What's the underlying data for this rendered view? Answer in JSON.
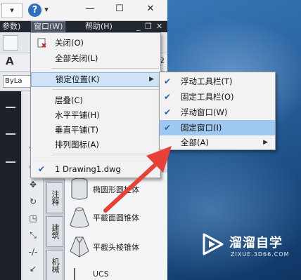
{
  "titlebar": {
    "help_glyph": "?",
    "minimize_glyph": "—",
    "maximize_glyph": "☐",
    "close_glyph": "✕"
  },
  "menubar": {
    "left_fragment": "参数)",
    "window_menu": "窗口(W)",
    "help_menu": "帮助(H)",
    "doc_min": "_",
    "doc_restore": "❐",
    "doc_close": "✕"
  },
  "toolbar": {
    "bylayer": "ByLa",
    "right_fragment": "-2"
  },
  "window_menu": {
    "items": [
      {
        "label": "关闭(O)",
        "icon": "close-document-icon"
      },
      {
        "label": "全部关闭(L)"
      },
      {
        "label": "锁定位置(K)",
        "highlighted": true,
        "has_submenu": true
      },
      {
        "label": "层叠(C)"
      },
      {
        "label": "水平平铺(H)"
      },
      {
        "label": "垂直平铺(T)"
      },
      {
        "label": "排列图标(A)"
      },
      {
        "label": "1 Drawing1.dwg",
        "checked": true
      }
    ]
  },
  "lock_submenu": {
    "items": [
      {
        "label": "浮动工具栏(T)",
        "checked": true
      },
      {
        "label": "固定工具栏(O)",
        "checked": true
      },
      {
        "label": "浮动窗口(W)",
        "checked": true
      },
      {
        "label": "固定窗口(I)",
        "checked": true,
        "highlighted": true
      },
      {
        "label": "全部(A)",
        "has_submenu": true
      }
    ]
  },
  "tool_palette": {
    "tabs": [
      "注释",
      "建筑",
      "机械"
    ],
    "tools": [
      {
        "label": "椭圆形圆柱体"
      },
      {
        "label": "平截面圆锥体"
      },
      {
        "label": "平截头棱锥体"
      },
      {
        "label": "UCS"
      }
    ]
  },
  "watermark": {
    "title": "溜溜自学",
    "url": "ZIXUE.3D66.COM"
  },
  "colors": {
    "menu_highlight": "#cfe3f7",
    "submenu_highlight": "#9ec8ef",
    "check": "#1f66b8",
    "annotation_arrow": "#e8413a"
  }
}
